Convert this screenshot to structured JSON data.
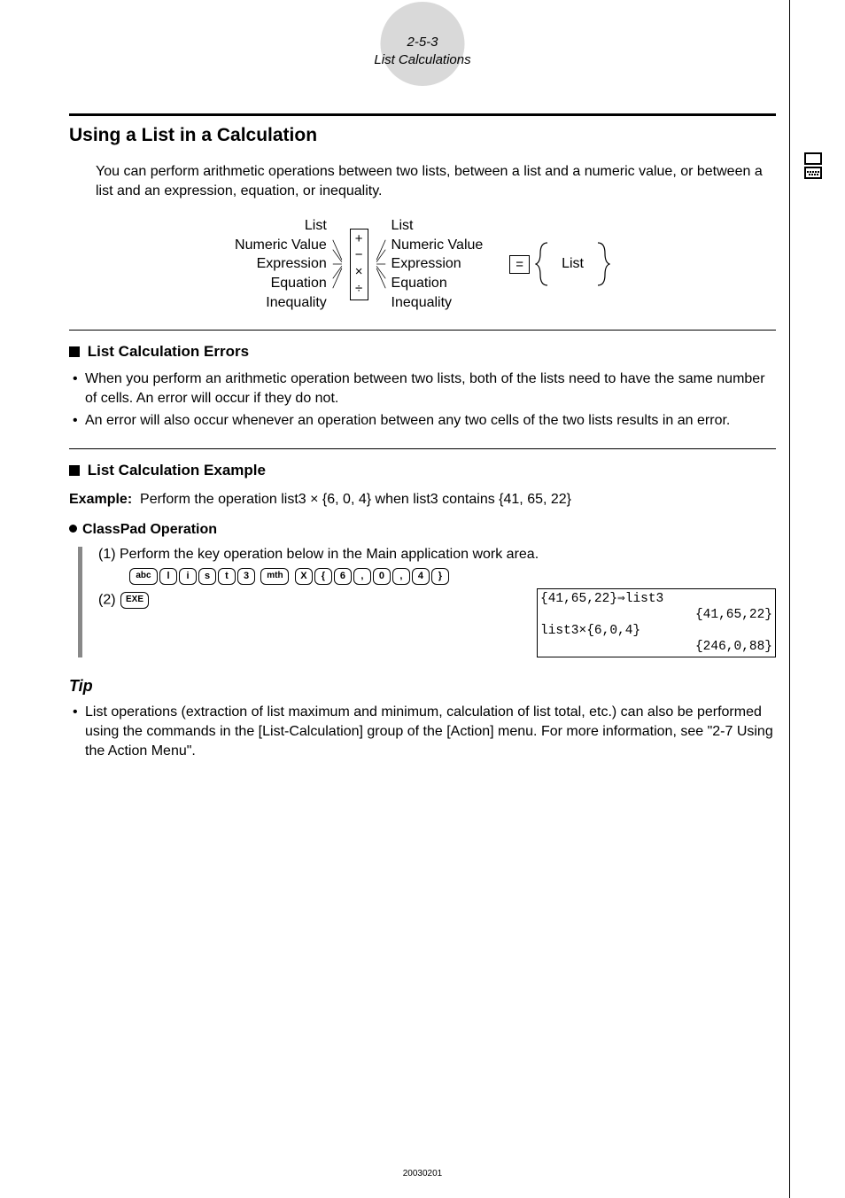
{
  "header": {
    "page_ref": "2-5-3",
    "section": "List Calculations"
  },
  "title": "Using a List in a Calculation",
  "intro": "You can perform arithmetic operations between two lists, between a list and a numeric value, or between a list and an expression, equation, or inequality.",
  "diagram": {
    "left": [
      "List",
      "Numeric Value",
      "Expression",
      "Equation",
      "Inequality"
    ],
    "ops": [
      "+",
      "−",
      "×",
      "÷"
    ],
    "right": [
      "List",
      "Numeric Value",
      "Expression",
      "Equation",
      "Inequality"
    ],
    "equals": "=",
    "result": "List"
  },
  "sec_errors": {
    "heading": "List Calculation Errors",
    "items": [
      "When you perform an arithmetic operation between two lists, both of the lists need to have the same number of cells. An error will occur if they do not.",
      "An error will also occur whenever an operation between any two cells of the two lists results in an error."
    ]
  },
  "sec_example": {
    "heading": "List Calculation Example",
    "label": "Example:",
    "text_pre": "Perform the operation list3 ",
    "text_op": "×",
    "text_post": " {6, 0, 4} when list3 contains {41, 65, 22}"
  },
  "classpad": {
    "heading": "ClassPad Operation",
    "step1": "(1) Perform the key operation below in the Main application work area.",
    "keys": [
      "abc",
      "l",
      "i",
      "s",
      "t",
      "3",
      "mth",
      "X",
      "{",
      "6",
      ",",
      "0",
      ",",
      "4",
      "}"
    ],
    "step2_prefix": "(2)",
    "step2_key": "EXE"
  },
  "calc_screen": {
    "l1": "{41,65,22}⇒list3",
    "l2": "{41,65,22}",
    "l3": "list3×{6,0,4}",
    "l4": "{246,0,88}"
  },
  "tip": {
    "heading": "Tip",
    "text": "List operations (extraction of list maximum and minimum, calculation of list total, etc.) can also be performed using the commands in the [List-Calculation] group of the [Action] menu. For more information, see \"2-7 Using the Action Menu\"."
  },
  "footer": "20030201"
}
